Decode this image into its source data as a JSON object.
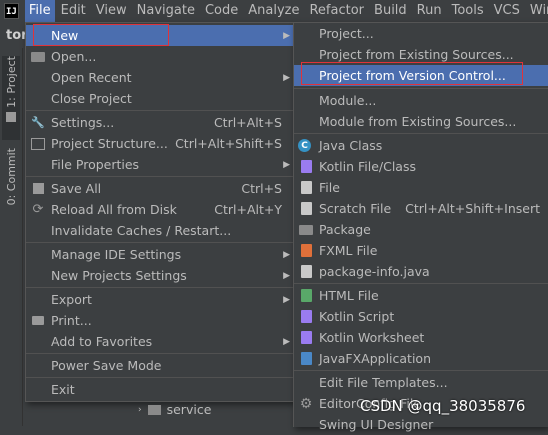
{
  "menubar": {
    "logo": "IJ",
    "items": [
      {
        "label": "File",
        "active": true
      },
      {
        "label": "Edit"
      },
      {
        "label": "View"
      },
      {
        "label": "Navigate"
      },
      {
        "label": "Code"
      },
      {
        "label": "Analyze"
      },
      {
        "label": "Refactor"
      },
      {
        "label": "Build"
      },
      {
        "label": "Run"
      },
      {
        "label": "Tools"
      },
      {
        "label": "VCS"
      },
      {
        "label": "Winc"
      }
    ]
  },
  "project_label": "tor",
  "tool_windows": [
    {
      "label": "1: Project",
      "icon": "folder-icon"
    },
    {
      "label": "0: Commit",
      "icon": "commit-icon"
    }
  ],
  "file_menu": {
    "items": [
      {
        "label": "New",
        "shortcut": "",
        "submenu": true,
        "icon": "",
        "selected": true
      },
      {
        "label": "Open...",
        "shortcut": "",
        "icon": "open-folder-icon"
      },
      {
        "label": "Open Recent",
        "shortcut": "",
        "submenu": true,
        "icon": ""
      },
      {
        "label": "Close Project",
        "shortcut": "",
        "icon": ""
      },
      {
        "label": "Settings...",
        "shortcut": "Ctrl+Alt+S",
        "icon": "wrench-icon"
      },
      {
        "label": "Project Structure...",
        "shortcut": "Ctrl+Alt+Shift+S",
        "icon": "project-structure-icon"
      },
      {
        "label": "File Properties",
        "shortcut": "",
        "submenu": true,
        "icon": ""
      },
      {
        "label": "Save All",
        "shortcut": "Ctrl+S",
        "icon": "save-icon"
      },
      {
        "label": "Reload All from Disk",
        "shortcut": "Ctrl+Alt+Y",
        "icon": "reload-icon"
      },
      {
        "label": "Invalidate Caches / Restart...",
        "shortcut": "",
        "icon": ""
      },
      {
        "label": "Manage IDE Settings",
        "shortcut": "",
        "submenu": true,
        "icon": ""
      },
      {
        "label": "New Projects Settings",
        "shortcut": "",
        "submenu": true,
        "icon": ""
      },
      {
        "label": "Export",
        "shortcut": "",
        "submenu": true,
        "icon": ""
      },
      {
        "label": "Print...",
        "shortcut": "",
        "icon": "print-icon"
      },
      {
        "label": "Add to Favorites",
        "shortcut": "",
        "submenu": true,
        "icon": ""
      },
      {
        "label": "Power Save Mode",
        "shortcut": "",
        "icon": ""
      },
      {
        "label": "Exit",
        "shortcut": "",
        "icon": ""
      }
    ]
  },
  "new_submenu": {
    "items": [
      {
        "label": "Project...",
        "icon": ""
      },
      {
        "label": "Project from Existing Sources...",
        "icon": ""
      },
      {
        "label": "Project from Version Control...",
        "icon": "",
        "highlighted": true
      },
      {
        "label": "Module...",
        "icon": ""
      },
      {
        "label": "Module from Existing Sources...",
        "icon": ""
      },
      {
        "label": "Java Class",
        "icon": "java-class-icon",
        "glyph": "C",
        "color": "#3592c4"
      },
      {
        "label": "Kotlin File/Class",
        "icon": "kotlin-file-icon",
        "glyph": "K",
        "color": "#9a7cf0"
      },
      {
        "label": "File",
        "icon": "file-icon",
        "glyph": "",
        "color": "#c9c9c9"
      },
      {
        "label": "Scratch File",
        "icon": "scratch-file-icon",
        "glyph": "",
        "color": "#c9c9c9",
        "shortcut": "Ctrl+Alt+Shift+Insert"
      },
      {
        "label": "Package",
        "icon": "package-icon",
        "glyph": "",
        "color": "#8a8a8a"
      },
      {
        "label": "FXML File",
        "icon": "fxml-file-icon",
        "glyph": "<>",
        "color": "#e0703a"
      },
      {
        "label": "package-info.java",
        "icon": "package-info-icon",
        "glyph": "",
        "color": "#c9c9c9"
      },
      {
        "label": "HTML File",
        "icon": "html-file-icon",
        "glyph": "H",
        "color": "#59a869"
      },
      {
        "label": "Kotlin Script",
        "icon": "kotlin-script-icon",
        "glyph": "K",
        "color": "#9a7cf0"
      },
      {
        "label": "Kotlin Worksheet",
        "icon": "kotlin-worksheet-icon",
        "glyph": "K",
        "color": "#9a7cf0"
      },
      {
        "label": "JavaFXApplication",
        "icon": "javafx-app-icon",
        "glyph": "",
        "color": "#4a88c7"
      },
      {
        "label": "Edit File Templates...",
        "icon": ""
      },
      {
        "label": "EditorConfig File",
        "icon": "gear-icon",
        "glyph": "⚙",
        "color": "#9a9a9a"
      },
      {
        "label": "Swing UI Designer",
        "icon": ""
      }
    ]
  },
  "tree": {
    "service_label": "service"
  },
  "watermark": "CSDN @qq_38035876",
  "colors": {
    "background": "#3c3f41",
    "selection": "#4b6eaf",
    "highlight_box": "#e0333a",
    "text": "#bbbbbb"
  }
}
